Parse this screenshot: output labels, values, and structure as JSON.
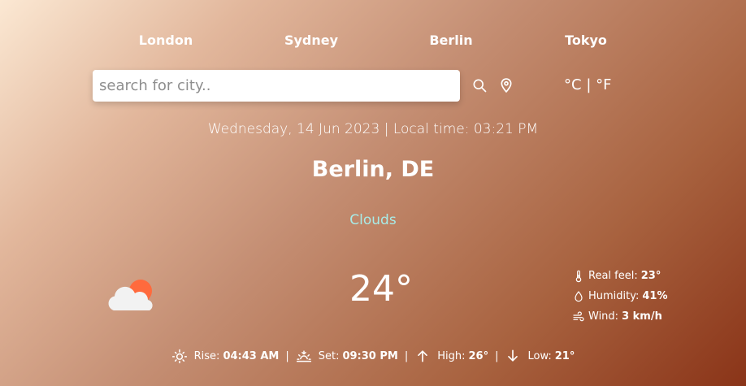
{
  "cities": [
    "London",
    "Sydney",
    "Berlin",
    "Tokyo"
  ],
  "search": {
    "placeholder": "search for city.."
  },
  "units": {
    "celsius": "°C",
    "separator": "|",
    "fahrenheit": "°F"
  },
  "datetime": "Wednesday, 14 Jun 2023 | Local time: 03:21 PM",
  "location": "Berlin, DE",
  "condition": "Clouds",
  "temperature": "24°",
  "weather_icon": "cloud-sun-icon",
  "details": {
    "real_feel_label": "Real feel:",
    "real_feel_value": "23°",
    "humidity_label": "Humidity:",
    "humidity_value": "41%",
    "wind_label": "Wind:",
    "wind_value": "3 km/h"
  },
  "sun": {
    "rise_label": "Rise:",
    "rise_value": "04:43 AM",
    "set_label": "Set:",
    "set_value": "09:30 PM",
    "high_label": "High:",
    "high_value": "26°",
    "low_label": "Low:",
    "low_value": "21°",
    "separator": "|"
  },
  "colors": {
    "condition": "#a8ece8",
    "sun_icon": "#ff6a3d"
  }
}
